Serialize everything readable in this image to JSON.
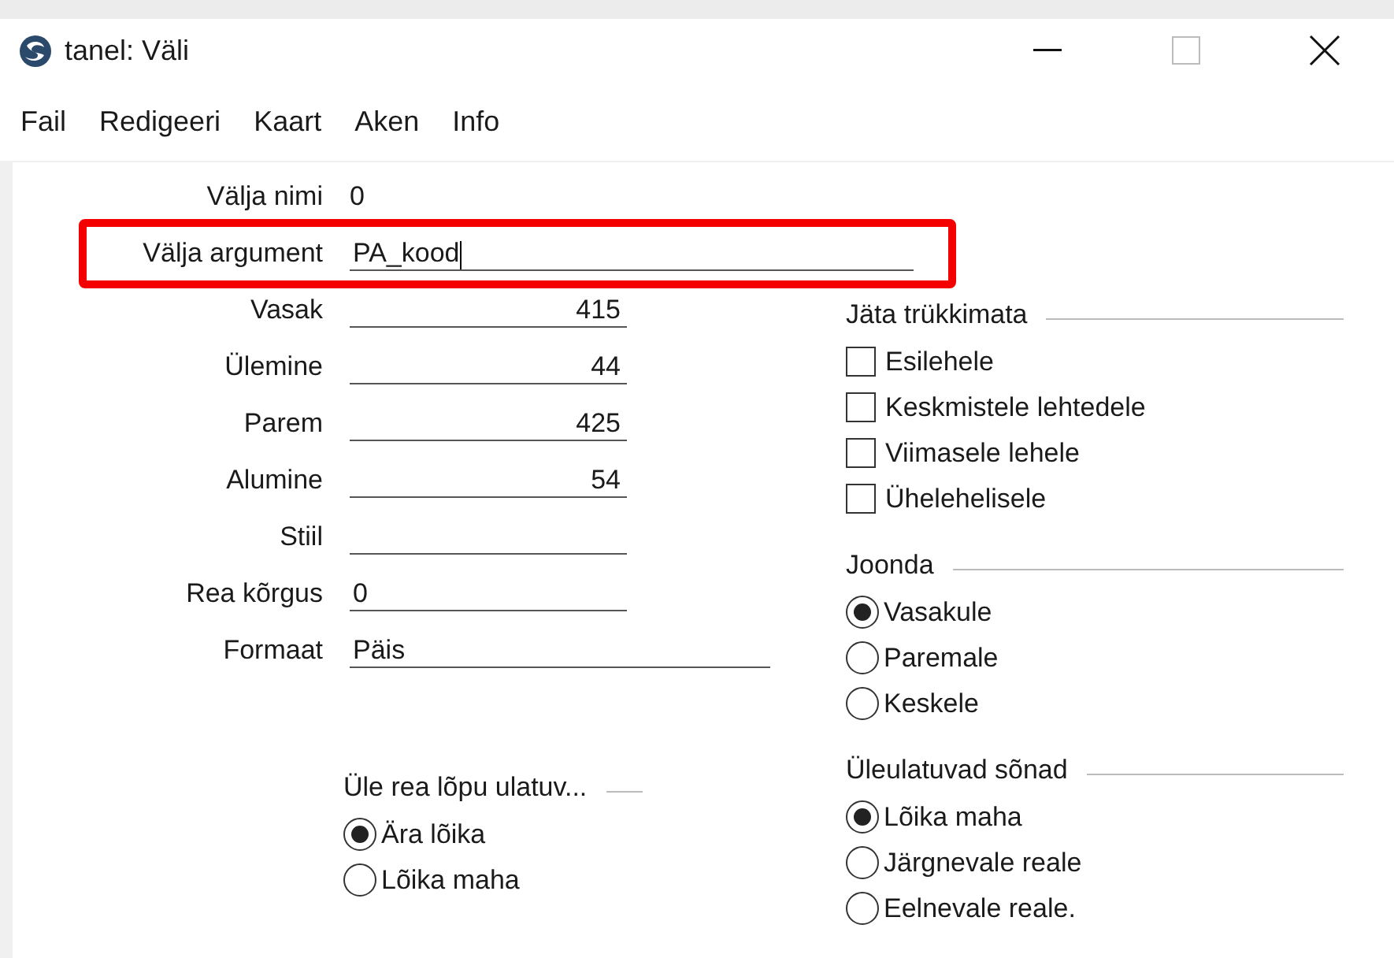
{
  "window": {
    "title": "tanel: Väli"
  },
  "menu": [
    "Fail",
    "Redigeeri",
    "Kaart",
    "Aken",
    "Info"
  ],
  "top_fields": [
    {
      "label": "Välja nimi",
      "value": "0",
      "kind": "plain",
      "highlighted": false
    },
    {
      "label": "Välja argument",
      "value": "PA_kood",
      "kind": "input",
      "highlighted": true
    }
  ],
  "fields": [
    {
      "label": "Vasak",
      "value": "415",
      "kind": "number"
    },
    {
      "label": "Ülemine",
      "value": "44",
      "kind": "number"
    },
    {
      "label": "Parem",
      "value": "425",
      "kind": "number"
    },
    {
      "label": "Alumine",
      "value": "54",
      "kind": "number"
    },
    {
      "label": "Stiil",
      "kind": "text"
    },
    {
      "label": "Rea kõrgus",
      "value": "0",
      "kind": "text"
    },
    {
      "label": "Formaat",
      "value": "Päis",
      "kind": "wide"
    }
  ],
  "overflow_group": {
    "title": "Üle rea lõpu ulatuv...",
    "options": [
      {
        "label": "Ära lõika",
        "selected": true
      },
      {
        "label": "Lõika maha",
        "selected": false
      }
    ]
  },
  "no_print_group": {
    "title": "Jäta trükkimata",
    "options": [
      {
        "label": "Esilehele",
        "checked": false
      },
      {
        "label": "Keskmistele lehtedele",
        "checked": false
      },
      {
        "label": "Viimasele lehele",
        "checked": false
      },
      {
        "label": "Ühelehelisele",
        "checked": false
      }
    ]
  },
  "align_group": {
    "title": "Joonda",
    "options": [
      {
        "label": "Vasakule",
        "selected": true
      },
      {
        "label": "Paremale",
        "selected": false
      },
      {
        "label": "Keskele",
        "selected": false
      }
    ]
  },
  "words_group": {
    "title": "Üleulatuvad sõnad",
    "options": [
      {
        "label": "Lõika maha",
        "selected": true
      },
      {
        "label": "Järgnevale reale",
        "selected": false
      },
      {
        "label": "Eelnevale reale.",
        "selected": false
      }
    ]
  }
}
